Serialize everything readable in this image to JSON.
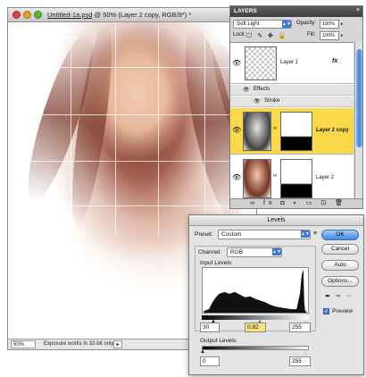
{
  "document": {
    "title_prefix": "",
    "filename": "Untitled-1a.psd",
    "title_rest": " @ 50% (Layer 2 copy, RGB/8*) *",
    "zoom": "50%",
    "status_text": "Exposure works in 32-bit only",
    "status_arrow": "▸"
  },
  "layers_panel": {
    "title": "LAYERS",
    "close_glyph": "×",
    "blend_mode": "Soft Light",
    "opacity_label": "Opacity:",
    "opacity_value": "100%",
    "lock_label": "Lock:",
    "lock_icons": "☐ ✎ ✥ 🔒",
    "fill_label": "Fill:",
    "fill_value": "100%",
    "layers": [
      {
        "name": "Layer 1",
        "fx": "fx",
        "effects_label": "Effects",
        "stroke_label": "Stroke"
      },
      {
        "name": "Layer 2 copy",
        "selected": true
      },
      {
        "name": "Layer 2"
      }
    ],
    "footer_icons": "∞ fx ◘ ◐ ▭ ⊡ 🗑"
  },
  "levels": {
    "title": "Levels",
    "preset_label": "Preset:",
    "preset_value": "Custom",
    "preset_menu_icon": "≡",
    "channel_label": "Channel:",
    "channel_value": "RGB",
    "input_levels_label": "Input Levels:",
    "input_black": "30",
    "input_gamma": "0.92",
    "input_white": "255",
    "output_levels_label": "Output Levels:",
    "output_black": "0",
    "output_white": "255",
    "buttons": {
      "ok": "OK",
      "cancel": "Cancel",
      "auto": "Auto",
      "options": "Options..."
    },
    "preview_label": "Preview",
    "preview_checked": true,
    "eyedroppers": [
      "black-eyedropper-icon",
      "gray-eyedropper-icon",
      "white-eyedropper-icon"
    ]
  },
  "colors": {
    "selected_layer": "#f9d94a",
    "accent_blue": "#3c88e0"
  }
}
